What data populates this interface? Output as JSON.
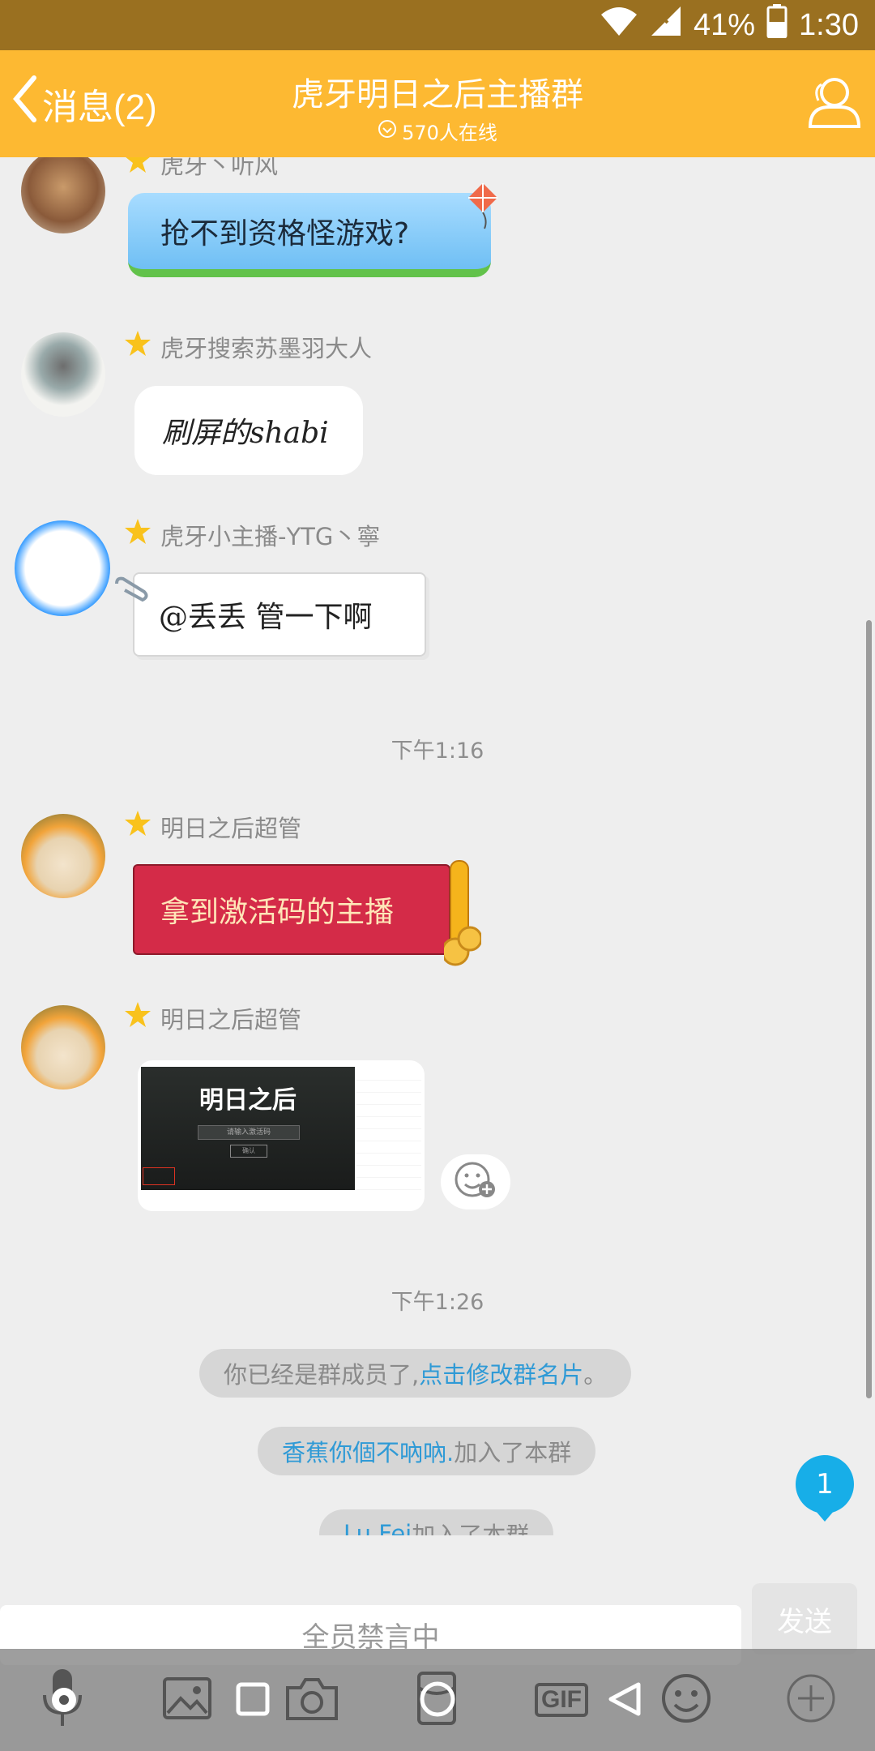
{
  "status_bar": {
    "battery": "41%",
    "time": "1:30"
  },
  "header": {
    "back_label": "消息(2)",
    "title": "虎牙明日之后主播群",
    "online": "570人在线"
  },
  "messages": [
    {
      "sender": "虎牙丶听风",
      "text": "抢不到资格怪游戏?"
    },
    {
      "sender": "虎牙搜索苏墨羽大人",
      "text": "刷屏的shabi"
    },
    {
      "sender": "虎牙小主播-YTG丶寧",
      "text": "@丢丢 管一下啊"
    },
    {
      "sender": "明日之后超管",
      "text": "拿到激活码的主播"
    },
    {
      "sender": "明日之后超管",
      "image_title": "明日之后",
      "image_text": "请输入激活码",
      "image_button": "确认"
    }
  ],
  "timestamps": [
    "下午1:16",
    "下午1:26"
  ],
  "system_messages": {
    "member_notice": {
      "text": "你已经是群成员了,",
      "link": "点击修改群名片",
      "end": "。"
    },
    "join1": {
      "name": "香蕉你個不吶吶.",
      "text": " 加入了本群"
    },
    "join2": {
      "name": "Lu Fei",
      "text": " 加入了本群"
    }
  },
  "unread_badge": "1",
  "input": {
    "placeholder": "全员禁言中",
    "send_label": "发送"
  },
  "toolbar": {
    "gif_label": "GIF"
  },
  "colors": {
    "header": "#fdb932",
    "status_bar": "#9a7020",
    "link": "#2f9ad6",
    "badge": "#17aee8",
    "red_bubble": "#d42b48"
  }
}
